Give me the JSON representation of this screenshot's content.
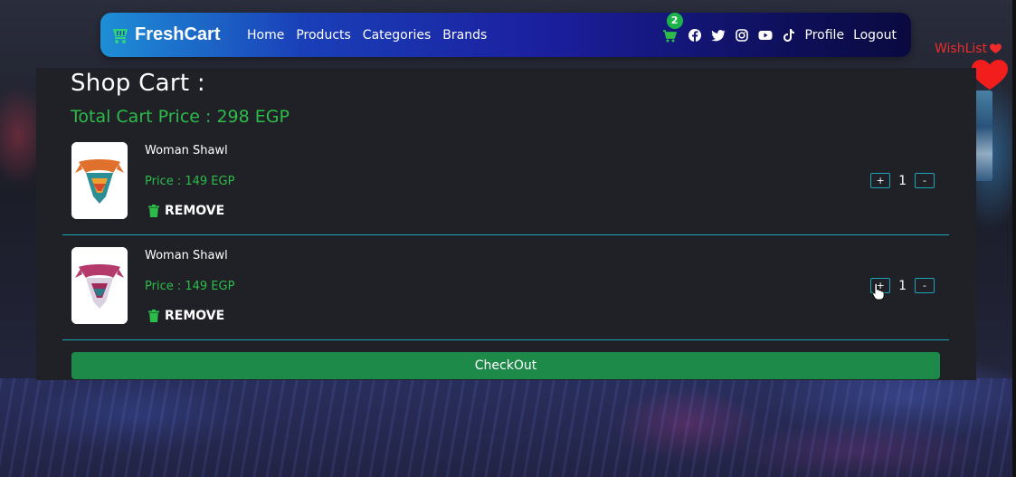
{
  "navbar": {
    "brand": "FreshCart",
    "links": [
      "Home",
      "Products",
      "Categories",
      "Brands"
    ],
    "cart_count": "2",
    "social_icons": [
      "facebook-icon",
      "twitter-icon",
      "instagram-icon",
      "youtube-icon",
      "tiktok-icon"
    ],
    "profile": "Profile",
    "logout": "Logout"
  },
  "wishlist": {
    "label": "WishList"
  },
  "cart": {
    "title": "Shop Cart :",
    "total": "Total Cart Price : 298 EGP",
    "items": [
      {
        "name": "Woman Shawl",
        "price": "Price : 149 EGP",
        "remove": "REMOVE",
        "qty": "1",
        "plus": "+",
        "minus": "-"
      },
      {
        "name": "Woman Shawl",
        "price": "Price : 149 EGP",
        "remove": "REMOVE",
        "qty": "1",
        "plus": "+",
        "minus": "-"
      }
    ],
    "checkout": "CheckOut"
  },
  "colors": {
    "accent_green": "#2dbb4a",
    "checkout_green": "#1e8a4a",
    "divider_teal": "#1aa6b7",
    "wishlist_red": "#ef2b2b"
  }
}
